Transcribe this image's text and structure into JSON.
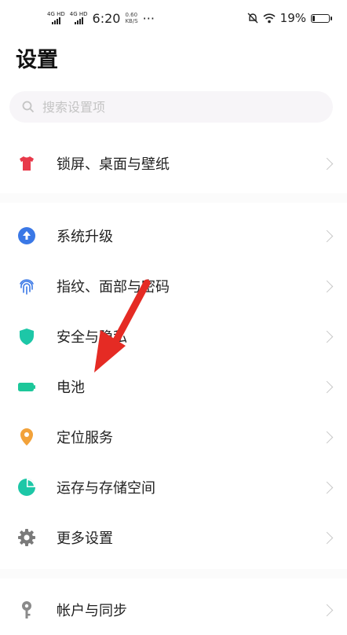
{
  "status_bar": {
    "sim1": "4G HD",
    "sim2": "4G HD",
    "time": "6:20",
    "net_speed": "0.60",
    "net_unit": "KB/S",
    "dots": "···",
    "battery": "19%"
  },
  "title": "设置",
  "search": {
    "placeholder": "搜索设置项"
  },
  "groups": [
    [
      {
        "label": "锁屏、桌面与壁纸",
        "icon": "tshirt-icon",
        "color": "#e8394a"
      }
    ],
    [
      {
        "label": "系统升级",
        "icon": "upgrade-icon",
        "color": "#3a78e6"
      },
      {
        "label": "指纹、面部与密码",
        "icon": "fingerprint-icon",
        "color": "#3a78e6"
      },
      {
        "label": "安全与隐私",
        "icon": "shield-icon",
        "color": "#1dc7a7"
      },
      {
        "label": "电池",
        "icon": "battery-icon",
        "color": "#1dc79a"
      },
      {
        "label": "定位服务",
        "icon": "location-icon",
        "color": "#f2a23a"
      },
      {
        "label": "运存与存储空间",
        "icon": "pie-chart-icon",
        "color": "#1dc7a7"
      },
      {
        "label": "更多设置",
        "icon": "gear-icon",
        "color": "#7a7a7a"
      }
    ],
    [
      {
        "label": "帐户与同步",
        "icon": "key-icon",
        "color": "#8a8a8a"
      }
    ]
  ],
  "colors": {
    "annotation_arrow": "#e52b24",
    "battery_level": 0.19
  }
}
